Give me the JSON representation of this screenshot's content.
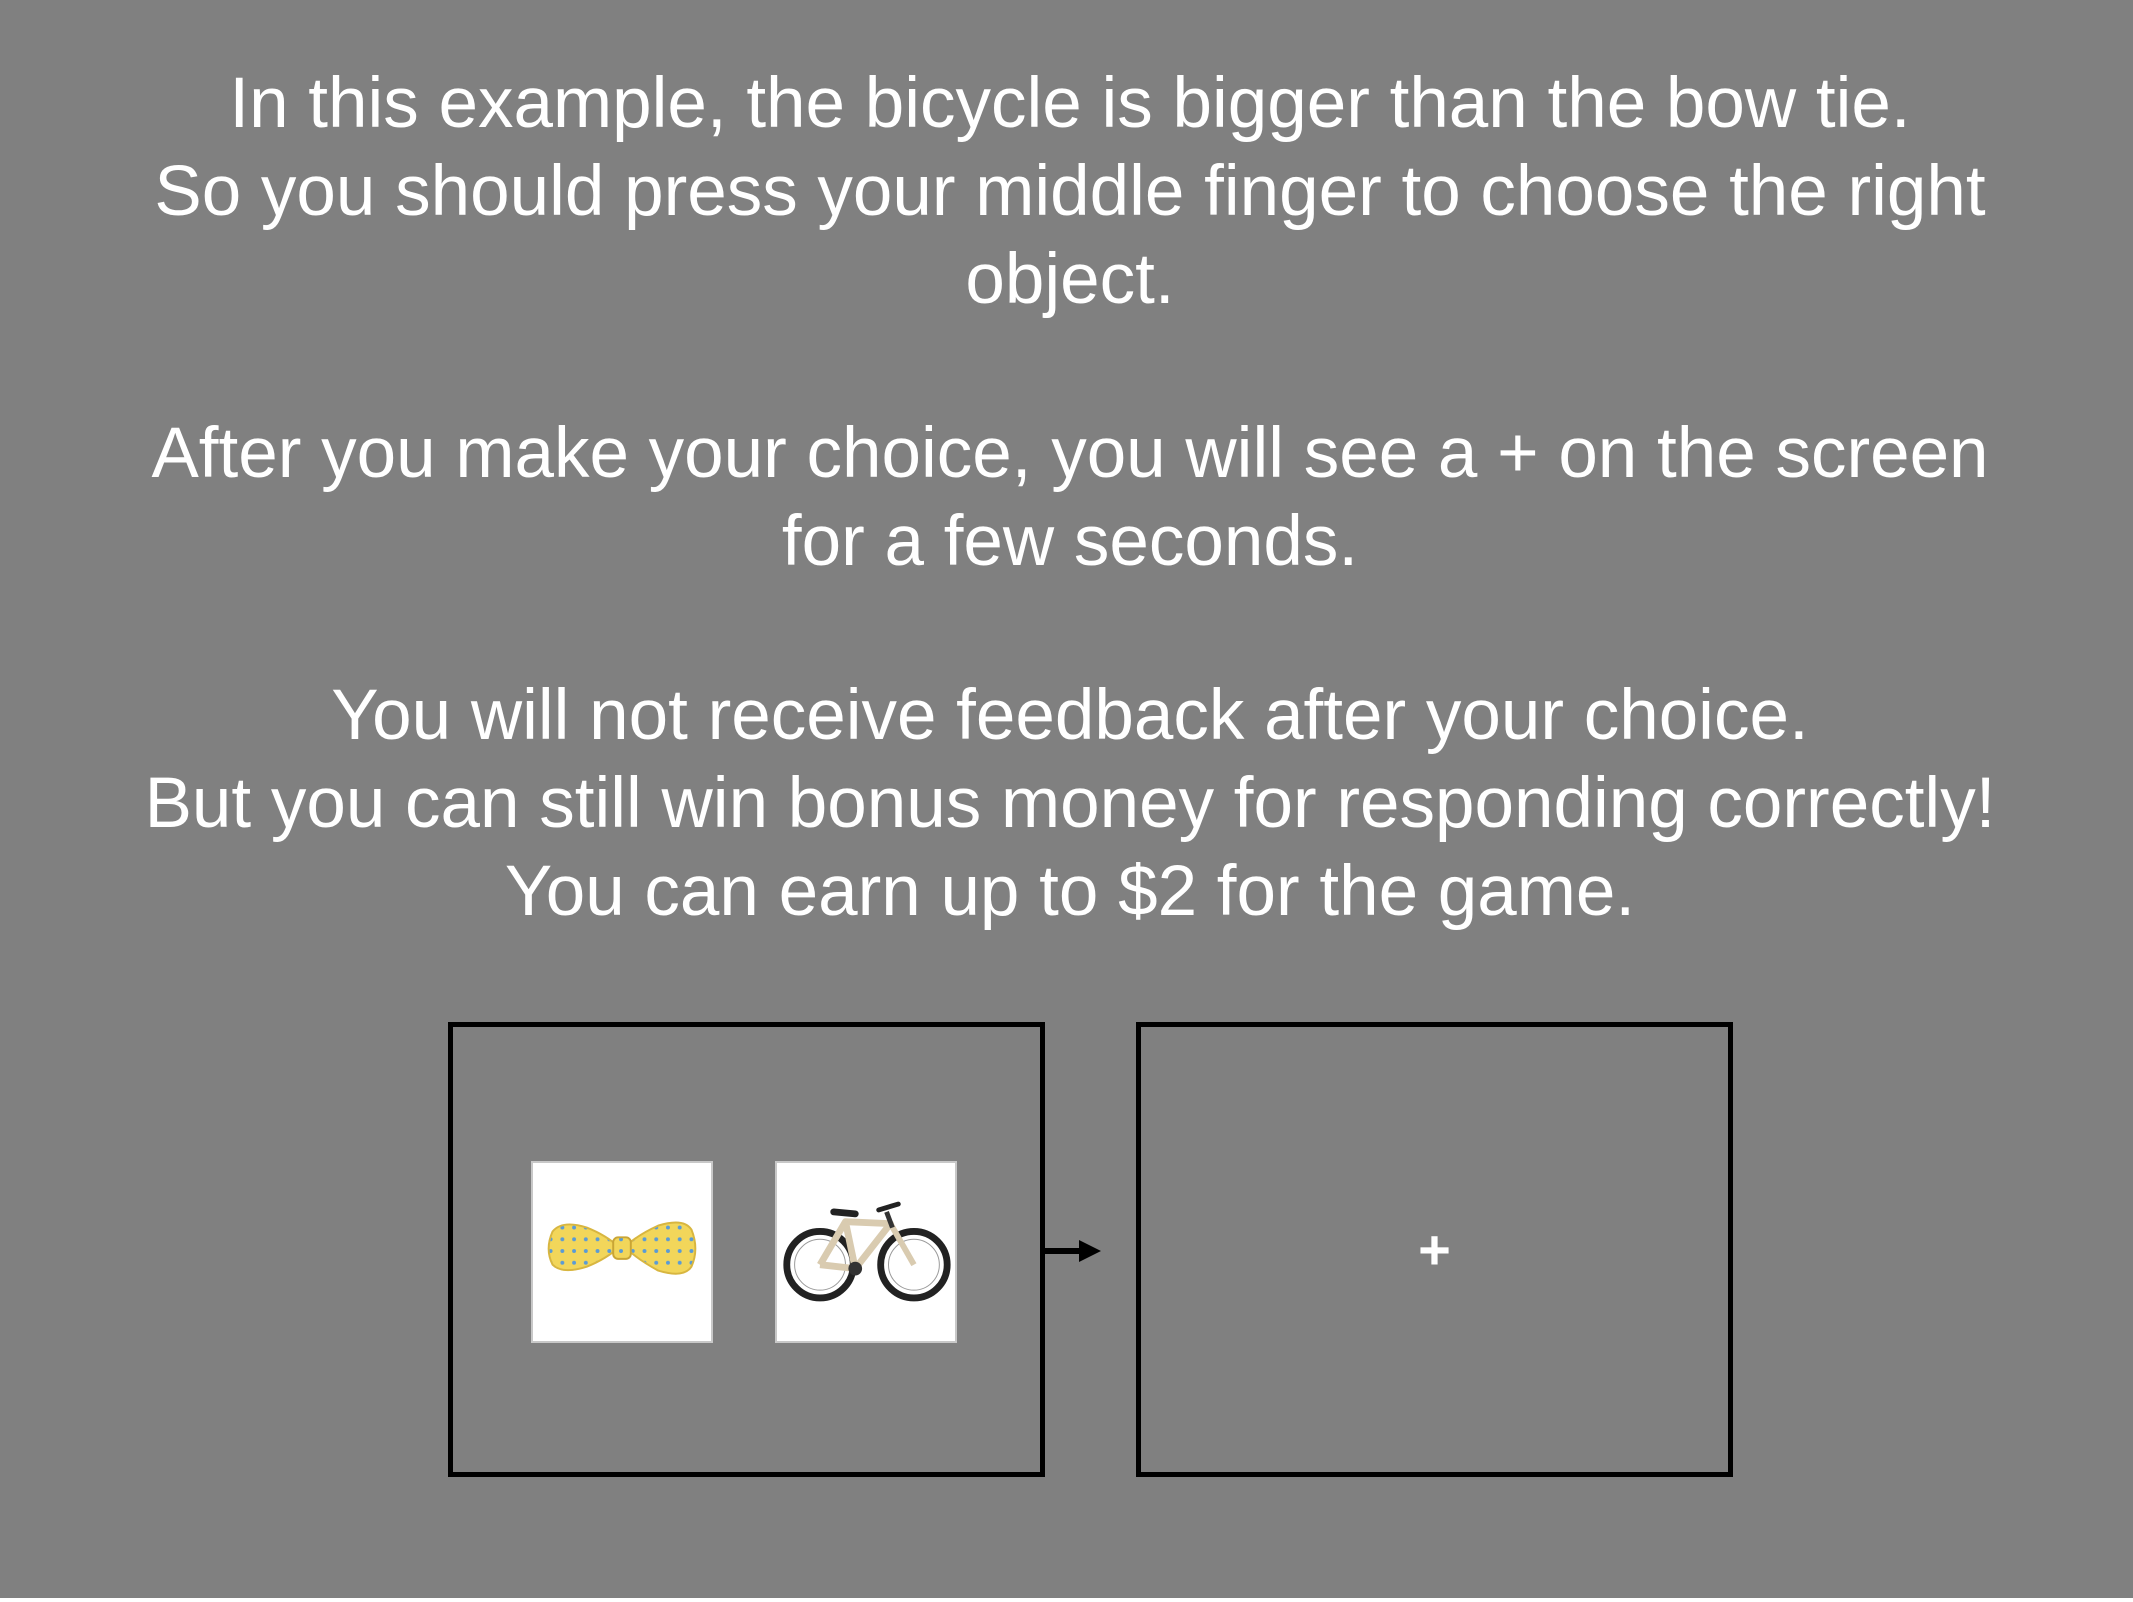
{
  "instructions": {
    "paragraph1": {
      "line1": "In this example, the bicycle is bigger than the bow tie.",
      "line2": "So you should press your middle finger to choose the right",
      "line3": "object."
    },
    "paragraph2": {
      "line1": "After you make your choice, you will see a + on the screen",
      "line2": "for a few seconds."
    },
    "paragraph3": {
      "line1": "You will not receive feedback after your choice.",
      "line2": "But you can still win bonus money for responding correctly!",
      "line3": "You can earn up to $2 for the game."
    }
  },
  "example": {
    "left_image": "bow-tie",
    "right_image": "bicycle",
    "fixation_symbol": "+"
  },
  "colors": {
    "background": "#808080",
    "text": "#ffffff",
    "frame_border": "#000000",
    "bow_tie": "#f2d65a"
  }
}
